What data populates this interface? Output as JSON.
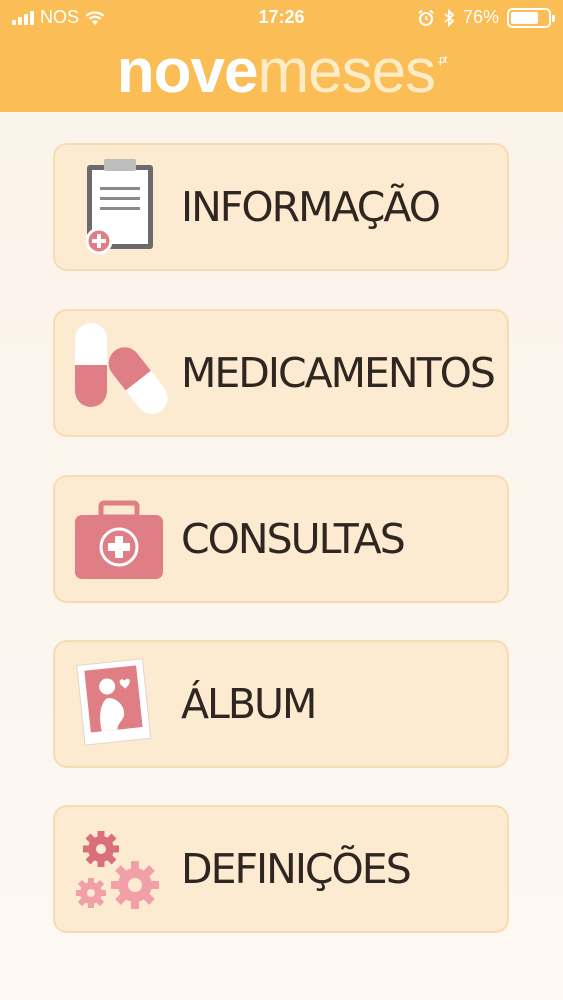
{
  "status_bar": {
    "carrier": "NOS",
    "time": "17:26",
    "battery_percent": "76%",
    "battery_level": 0.76
  },
  "logo": {
    "part1": "nove",
    "part2": "meses",
    "suffix": ".pt"
  },
  "menu": {
    "items": [
      {
        "label": "INFORMAÇÃO",
        "icon": "clipboard-icon"
      },
      {
        "label": "MEDICAMENTOS",
        "icon": "pills-icon"
      },
      {
        "label": "CONSULTAS",
        "icon": "medical-kit-icon"
      },
      {
        "label": "ÁLBUM",
        "icon": "photo-icon"
      },
      {
        "label": "DEFINIÇÕES",
        "icon": "gears-icon"
      }
    ]
  },
  "colors": {
    "header": "#fbbd56",
    "card": "#fcebd0",
    "accent": "#e07e86",
    "text": "#2f2622"
  }
}
